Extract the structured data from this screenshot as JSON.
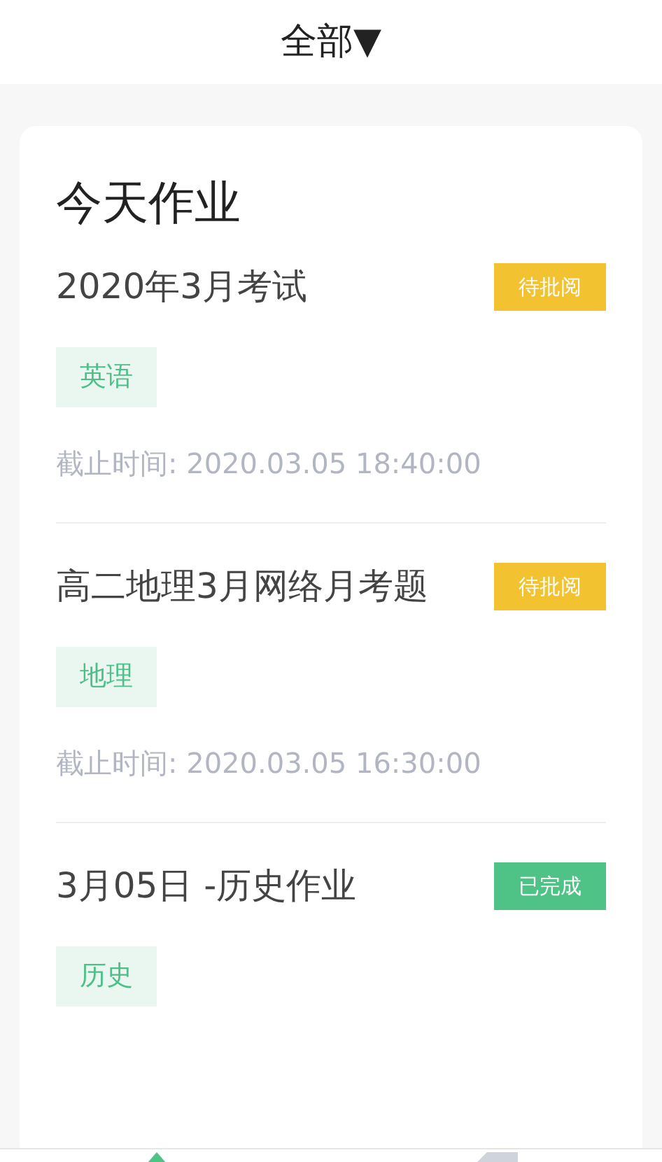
{
  "header": {
    "title": "全部▼"
  },
  "section": {
    "title": "今天作业"
  },
  "assignments": [
    {
      "title": "2020年3月考试",
      "status": {
        "kind": "pending",
        "label": "待批阅"
      },
      "subject": "英语",
      "deadline": "截止时间: 2020.03.05 18:40:00"
    },
    {
      "title": "高二地理3月网络月考题",
      "status": {
        "kind": "pending",
        "label": "待批阅"
      },
      "subject": "地理",
      "deadline": "截止时间: 2020.03.05 16:30:00"
    },
    {
      "title": "3月05日 -历史作业",
      "status": {
        "kind": "done",
        "label": "已完成"
      },
      "subject": "历史"
    }
  ]
}
